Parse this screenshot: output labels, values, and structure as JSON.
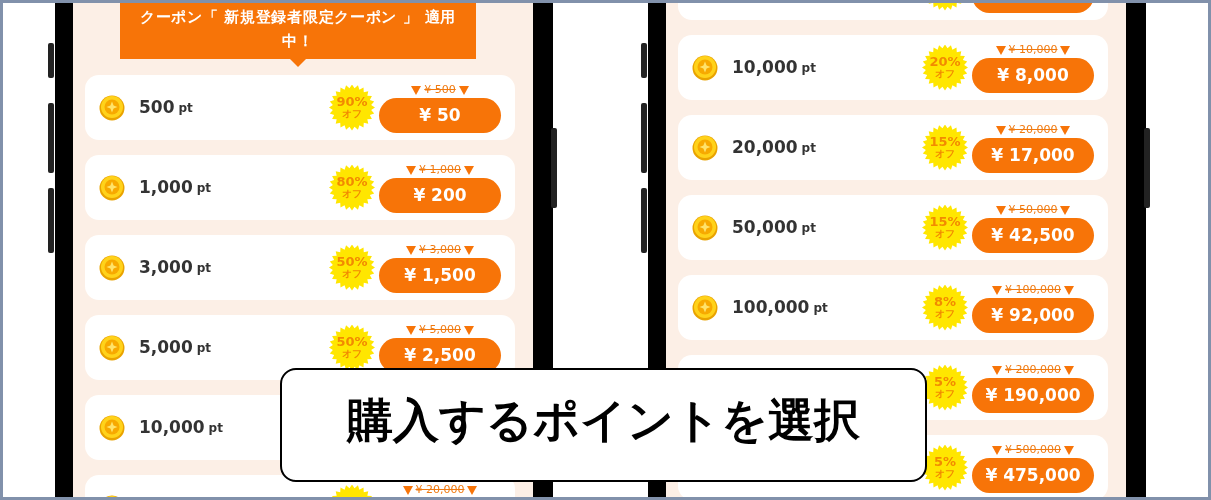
{
  "phones": [
    {
      "banner": "クーポン「 新規登録者限定クーポン 」 適用中！",
      "rows": [
        {
          "kind": "full",
          "points": "500",
          "unit": "pt",
          "discount": "90%",
          "discount_label": "オフ",
          "original_price": "¥ 500",
          "price": "¥ 50"
        },
        {
          "kind": "full",
          "points": "1,000",
          "unit": "pt",
          "discount": "80%",
          "discount_label": "オフ",
          "original_price": "¥ 1,000",
          "price": "¥ 200"
        },
        {
          "kind": "full",
          "points": "3,000",
          "unit": "pt",
          "discount": "50%",
          "discount_label": "オフ",
          "original_price": "¥ 3,000",
          "price": "¥ 1,500"
        },
        {
          "kind": "full",
          "points": "5,000",
          "unit": "pt",
          "discount": "50%",
          "discount_label": "オフ",
          "original_price": "¥ 5,000",
          "price": "¥ 2,500"
        },
        {
          "kind": "full",
          "points": "10,000",
          "unit": "pt"
        },
        {
          "kind": "cut",
          "original_price": "¥ 20,000"
        }
      ]
    },
    {
      "rows": [
        {
          "kind": "cut"
        },
        {
          "kind": "full",
          "points": "10,000",
          "unit": "pt",
          "discount": "20%",
          "discount_label": "オフ",
          "original_price": "¥ 10,000",
          "price": "¥ 8,000"
        },
        {
          "kind": "full",
          "points": "20,000",
          "unit": "pt",
          "discount": "15%",
          "discount_label": "オフ",
          "original_price": "¥ 20,000",
          "price": "¥ 17,000"
        },
        {
          "kind": "full",
          "points": "50,000",
          "unit": "pt",
          "discount": "15%",
          "discount_label": "オフ",
          "original_price": "¥ 50,000",
          "price": "¥ 42,500"
        },
        {
          "kind": "full",
          "points": "100,000",
          "unit": "pt",
          "discount": "8%",
          "discount_label": "オフ",
          "original_price": "¥ 100,000",
          "price": "¥ 92,000"
        },
        {
          "kind": "full",
          "discount": "5%",
          "discount_label": "オフ",
          "original_price": "¥ 200,000",
          "price": "¥ 190,000"
        },
        {
          "kind": "full",
          "discount": "5%",
          "discount_label": "オフ",
          "original_price": "¥ 500,000",
          "price": "¥ 475,000"
        }
      ]
    }
  ],
  "caption": "購入するポイントを選択"
}
